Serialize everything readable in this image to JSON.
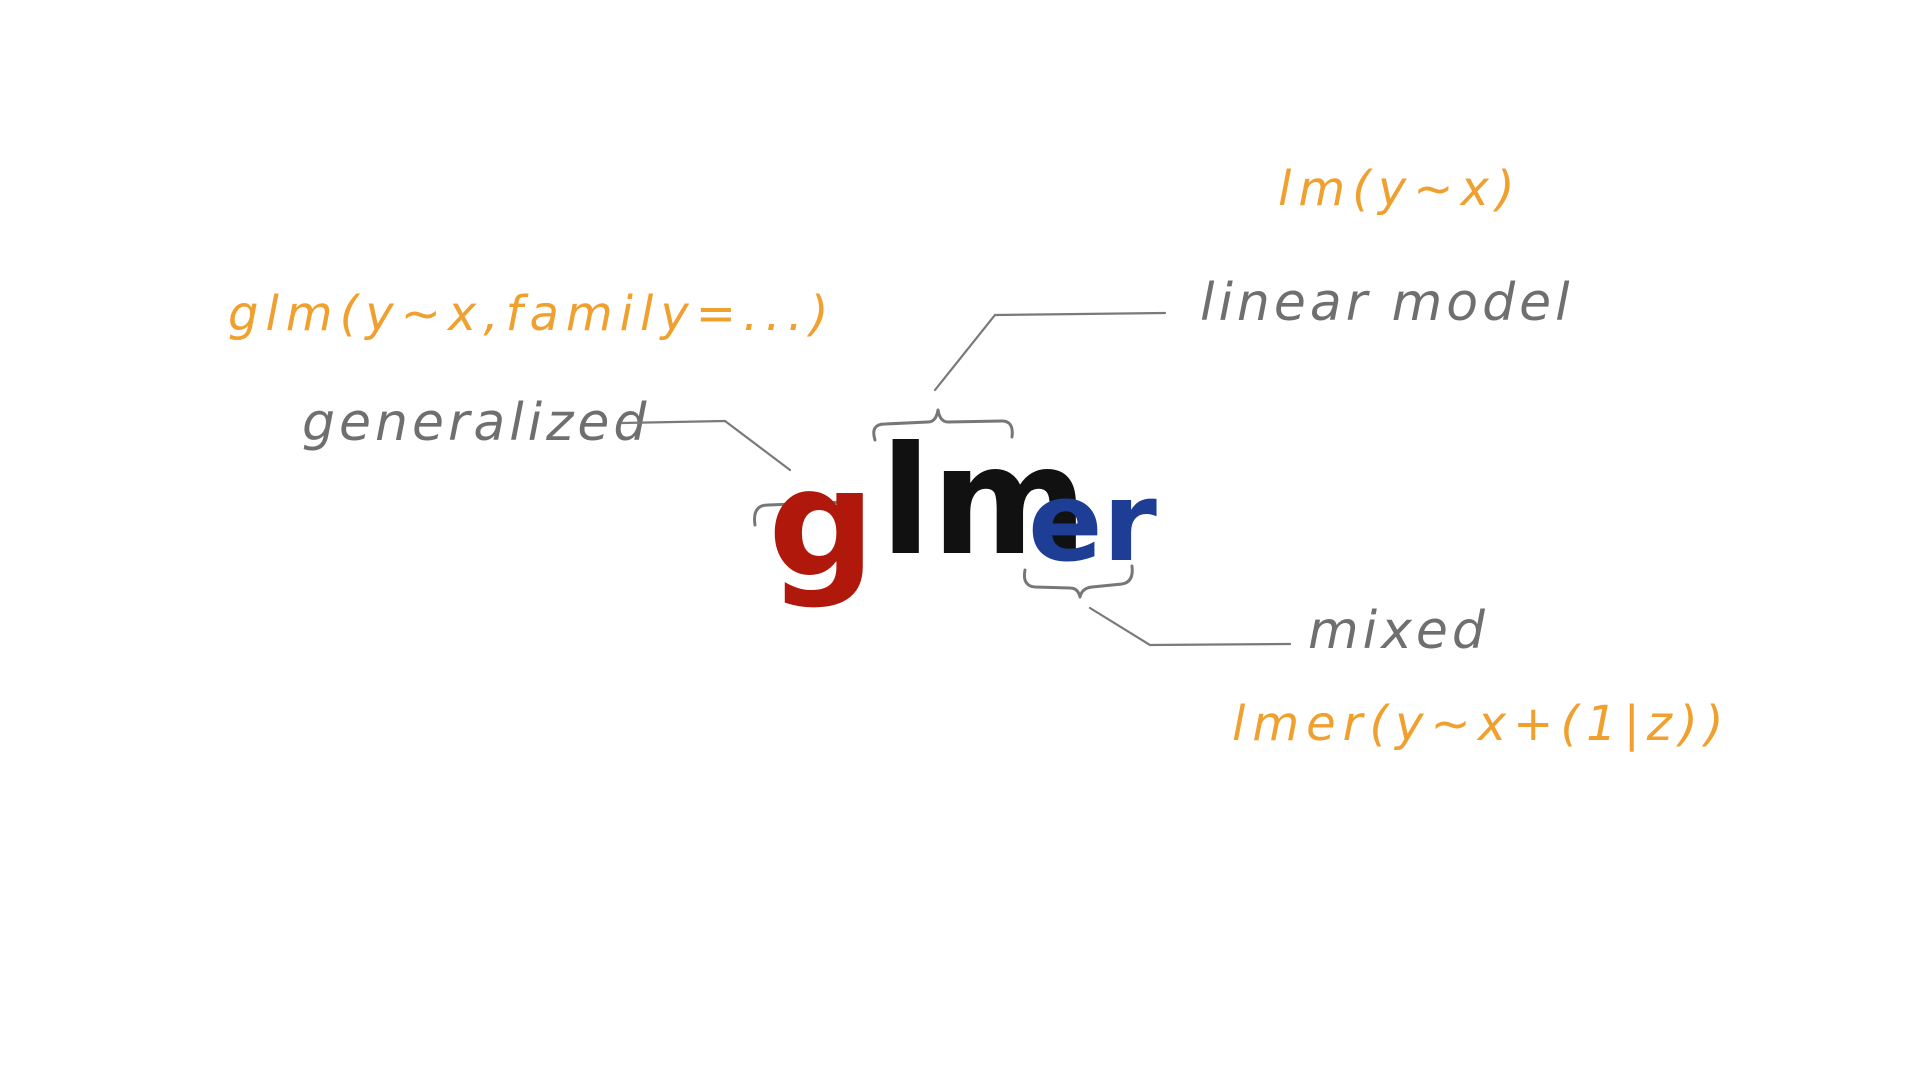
{
  "letters": {
    "g": "g",
    "lm": "lm",
    "er": "er"
  },
  "labels": {
    "generalized": "generalized",
    "linear_model": "linear model",
    "mixed": "mixed"
  },
  "code": {
    "glm": "glm(y~x,family=...)",
    "lm": "lm(y~x)",
    "lmer": "lmer(y~x+(1|z))"
  },
  "colors": {
    "g": "#b0180c",
    "lm": "#111111",
    "er": "#1d3e94",
    "code": "#f0a02e",
    "label": "#6f6f6f"
  }
}
